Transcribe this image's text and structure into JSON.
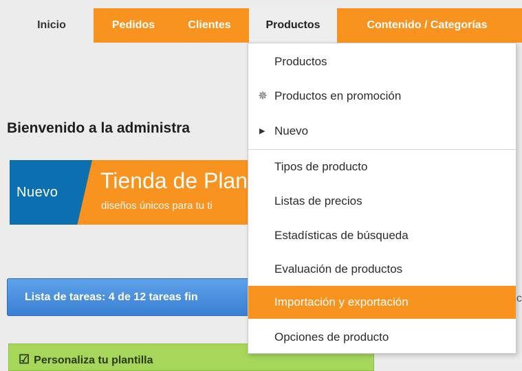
{
  "nav": {
    "items": [
      {
        "label": "Inicio"
      },
      {
        "label": "Pedidos"
      },
      {
        "label": "Clientes"
      },
      {
        "label": "Productos"
      },
      {
        "label": "Contenido / Categorías"
      }
    ]
  },
  "main": {
    "welcome": "Bienvenido a la administra",
    "banner": {
      "badge": "Nuevo",
      "title": "Tienda de Plan",
      "subtitle": "diseños únicos para tu ti"
    },
    "tasks": "Lista de tareas: 4 de 12 tareas fin",
    "side_c": "c",
    "green_box": "Personaliza tu plantilla"
  },
  "dropdown": {
    "items": [
      {
        "label": "Productos"
      },
      {
        "label": "Productos en promoción",
        "icon": "promo-star-icon"
      },
      {
        "label": "Nuevo",
        "icon": "caret-right-icon"
      },
      {
        "label": "Tipos de producto"
      },
      {
        "label": "Listas de precios"
      },
      {
        "label": "Estadísticas de búsqueda"
      },
      {
        "label": "Evaluación de productos"
      },
      {
        "label": "Importación y exportación",
        "highlighted": true
      },
      {
        "label": "Opciones de producto"
      }
    ]
  },
  "colors": {
    "accent": "#f7931e",
    "badge_blue": "#0c6fb0",
    "tasks_blue": "#4a90e2",
    "green": "#a6d65a"
  }
}
